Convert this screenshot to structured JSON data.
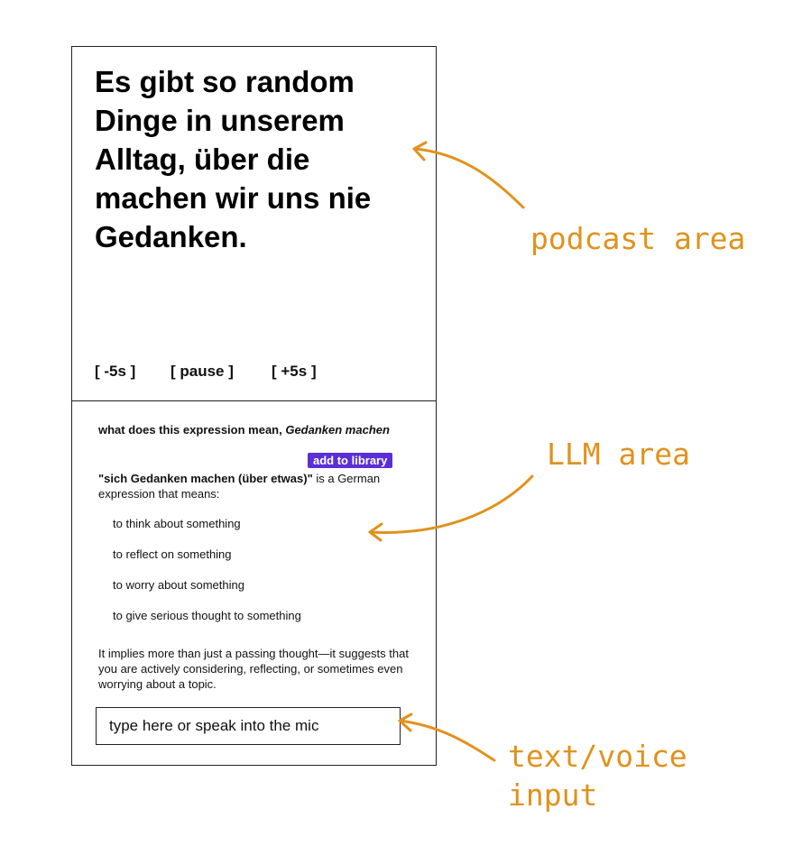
{
  "podcast": {
    "line1": "Es gibt so random",
    "line2": "Dinge in unserem",
    "line3": "Alltag, über die",
    "line4": "machen wir uns nie",
    "line5": "Gedanken.",
    "controls": {
      "back": "[ -5s ]",
      "pause": "[ pause ]",
      "forward": "[ +5s ]"
    }
  },
  "llm": {
    "question_prefix": "what does this expression mean, ",
    "question_phrase": "Gedanken machen",
    "add_button": "add to library",
    "answer_bold": "\"sich Gedanken machen (über etwas)\"",
    "answer_rest": " is a German expression that means:",
    "bullets": [
      "to think about something",
      "to reflect on something",
      "to worry about something",
      "to give serious thought to something"
    ],
    "summary": "It implies more than just a passing thought—it suggests that you are actively considering, reflecting, or sometimes even worrying about a topic."
  },
  "input": {
    "placeholder": "type here or speak into the mic"
  },
  "annotations": {
    "podcast": "podcast area",
    "llm": "LLM area",
    "input_line1": "text/voice",
    "input_line2": "input",
    "color": "#e0921c"
  },
  "colors": {
    "button": "#5b2fd6"
  }
}
